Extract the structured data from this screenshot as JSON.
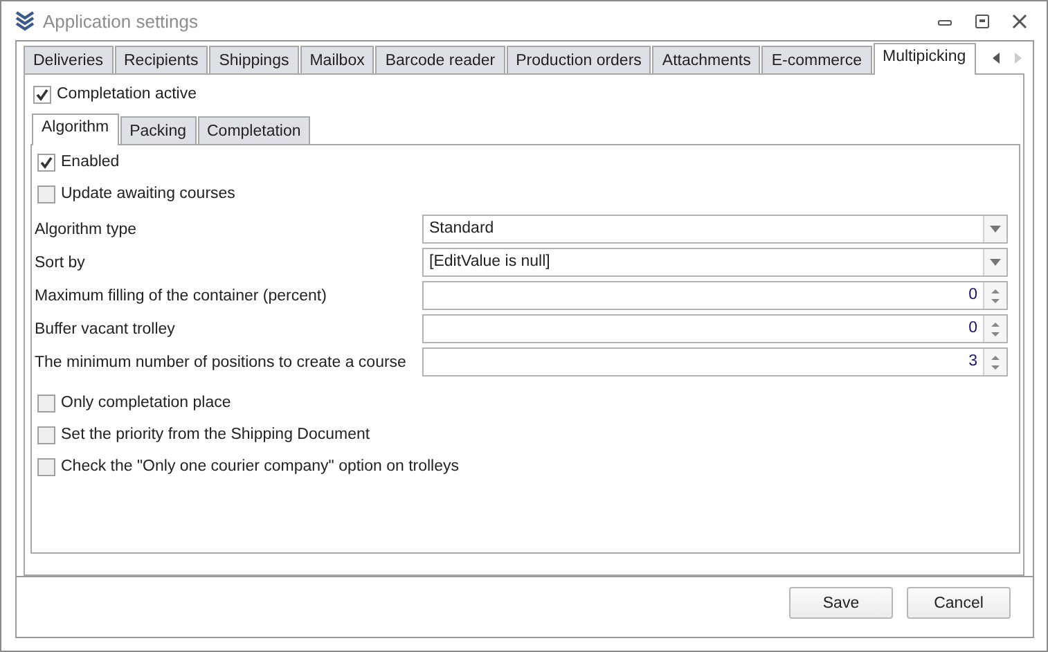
{
  "window": {
    "title": "Application settings"
  },
  "tabs": [
    {
      "label": "Deliveries",
      "selected": false
    },
    {
      "label": "Recipients",
      "selected": false
    },
    {
      "label": "Shippings",
      "selected": false
    },
    {
      "label": "Mailbox",
      "selected": false
    },
    {
      "label": "Barcode reader",
      "selected": false
    },
    {
      "label": "Production orders",
      "selected": false
    },
    {
      "label": "Attachments",
      "selected": false
    },
    {
      "label": "E-commerce",
      "selected": false
    },
    {
      "label": "Multipicking",
      "selected": true
    }
  ],
  "completion_active": {
    "label": "Completation active",
    "checked": true
  },
  "inner_tabs": [
    {
      "label": "Algorithm",
      "selected": true
    },
    {
      "label": "Packing",
      "selected": false
    },
    {
      "label": "Completation",
      "selected": false
    }
  ],
  "top_options": [
    {
      "label": "Enabled",
      "checked": true
    },
    {
      "label": "Update awaiting courses",
      "checked": false
    }
  ],
  "fields": [
    {
      "label": "Algorithm type",
      "kind": "combo",
      "value": "Standard"
    },
    {
      "label": "Sort by",
      "kind": "combo",
      "value": "[EditValue is null]"
    },
    {
      "label": "Maximum filling of the container (percent)",
      "kind": "spin",
      "value": "0"
    },
    {
      "label": "Buffer vacant trolley",
      "kind": "spin",
      "value": "0"
    },
    {
      "label": "The minimum number of positions to create a course",
      "kind": "spin",
      "value": "3"
    }
  ],
  "bottom_options": [
    {
      "label": "Only completation place",
      "checked": false
    },
    {
      "label": "Set the priority from the Shipping Document",
      "checked": false
    },
    {
      "label": "Check the \"Only one courier company\" option on trolleys",
      "checked": false
    }
  ],
  "buttons": [
    "Save",
    "Cancel"
  ]
}
